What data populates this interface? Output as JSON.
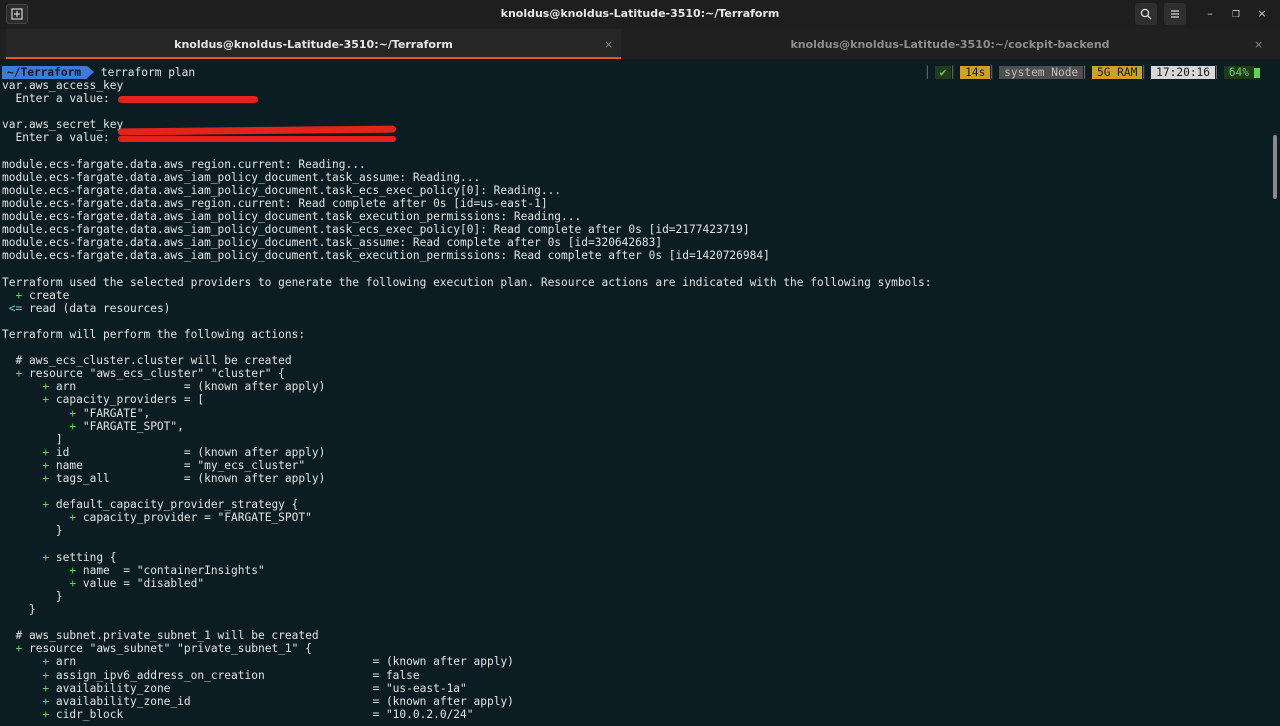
{
  "window": {
    "title": "knoldus@knoldus-Latitude-3510:~/Terraform"
  },
  "tabs": [
    {
      "label": "knoldus@knoldus-Latitude-3510:~/Terraform",
      "close": "×"
    },
    {
      "label": "knoldus@knoldus-Latitude-3510:~/cockpit-backend",
      "close": "×"
    }
  ],
  "prompt": {
    "path": "~/Terraform",
    "command": "terraform plan"
  },
  "status": {
    "check": "✔",
    "duration": "14s",
    "node": "system Node",
    "ram": "5G RAM",
    "time": "17:20:16",
    "battery": "64%"
  },
  "lines": [
    "var.aws_access_key",
    "  Enter a value: ",
    "",
    "var.aws_secret_key",
    "  Enter a value: ",
    "",
    "module.ecs-fargate.data.aws_region.current: Reading...",
    "module.ecs-fargate.data.aws_iam_policy_document.task_assume: Reading...",
    "module.ecs-fargate.data.aws_iam_policy_document.task_ecs_exec_policy[0]: Reading...",
    "module.ecs-fargate.data.aws_region.current: Read complete after 0s [id=us-east-1]",
    "module.ecs-fargate.data.aws_iam_policy_document.task_execution_permissions: Reading...",
    "module.ecs-fargate.data.aws_iam_policy_document.task_ecs_exec_policy[0]: Read complete after 0s [id=2177423719]",
    "module.ecs-fargate.data.aws_iam_policy_document.task_assume: Read complete after 0s [id=320642683]",
    "module.ecs-fargate.data.aws_iam_policy_document.task_execution_permissions: Read complete after 0s [id=1420726984]",
    "",
    "Terraform used the selected providers to generate the following execution plan. Resource actions are indicated with the following symbols:",
    "  + create",
    " <= read (data resources)",
    "",
    "Terraform will perform the following actions:",
    "",
    "  # aws_ecs_cluster.cluster will be created",
    "  + resource \"aws_ecs_cluster\" \"cluster\" {",
    "      + arn                = (known after apply)",
    "      + capacity_providers = [",
    "          + \"FARGATE\",",
    "          + \"FARGATE_SPOT\",",
    "        ]",
    "      + id                 = (known after apply)",
    "      + name               = \"my_ecs_cluster\"",
    "      + tags_all           = (known after apply)",
    "",
    "      + default_capacity_provider_strategy {",
    "          + capacity_provider = \"FARGATE_SPOT\"",
    "        }",
    "",
    "      + setting {",
    "          + name  = \"containerInsights\"",
    "          + value = \"disabled\"",
    "        }",
    "    }",
    "",
    "  # aws_subnet.private_subnet_1 will be created",
    "  + resource \"aws_subnet\" \"private_subnet_1\" {",
    "      + arn                                            = (known after apply)",
    "      + assign_ipv6_address_on_creation                = false",
    "      + availability_zone                              = \"us-east-1a\"",
    "      + availability_zone_id                           = (known after apply)",
    "      + cidr_block                                     = \"10.0.2.0/24\""
  ]
}
